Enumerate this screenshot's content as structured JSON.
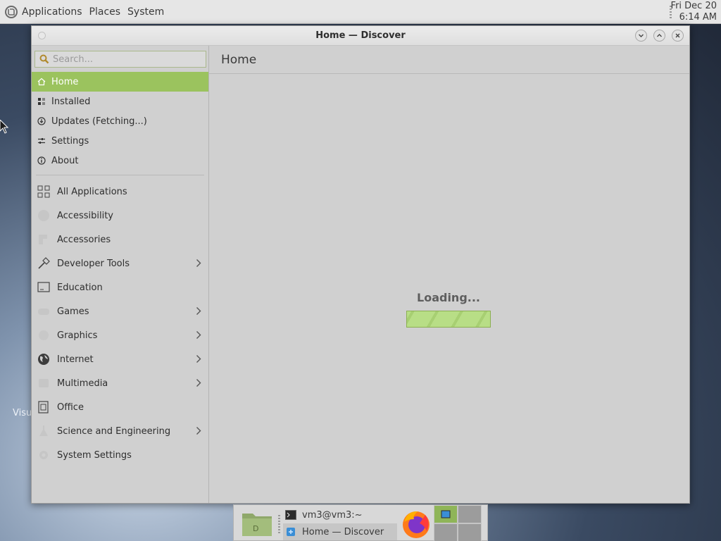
{
  "top_panel": {
    "menus": [
      "Applications",
      "Places",
      "System"
    ],
    "clock_date": "Fri Dec 20",
    "clock_time": "6:14 AM"
  },
  "desktop": {
    "label": "Visu"
  },
  "window": {
    "title": "Home — Discover",
    "search_placeholder": "Search...",
    "nav_items": [
      {
        "label": "Home",
        "icon": "home-icon",
        "active": true
      },
      {
        "label": "Installed",
        "icon": "installed-icon"
      },
      {
        "label": "Updates (Fetching...)",
        "icon": "updates-icon"
      },
      {
        "label": "Settings",
        "icon": "settings-icon"
      },
      {
        "label": "About",
        "icon": "info-icon"
      }
    ],
    "categories": [
      {
        "label": "All Applications",
        "icon": "grid-icon",
        "has_children": false
      },
      {
        "label": "Accessibility",
        "icon": "accessibility-icon",
        "has_children": false
      },
      {
        "label": "Accessories",
        "icon": "accessories-icon",
        "has_children": false
      },
      {
        "label": "Developer Tools",
        "icon": "hammer-icon",
        "has_children": true
      },
      {
        "label": "Education",
        "icon": "education-icon",
        "has_children": false
      },
      {
        "label": "Games",
        "icon": "games-icon",
        "has_children": true
      },
      {
        "label": "Graphics",
        "icon": "graphics-icon",
        "has_children": true
      },
      {
        "label": "Internet",
        "icon": "globe-icon",
        "has_children": true
      },
      {
        "label": "Multimedia",
        "icon": "multimedia-icon",
        "has_children": true
      },
      {
        "label": "Office",
        "icon": "office-icon",
        "has_children": false
      },
      {
        "label": "Science and Engineering",
        "icon": "science-icon",
        "has_children": true
      },
      {
        "label": "System Settings",
        "icon": "system-settings-icon",
        "has_children": false
      }
    ],
    "main_title": "Home",
    "loading_text": "Loading..."
  },
  "taskbar": {
    "tasks": [
      {
        "label": "vm3@vm3:~",
        "icon": "terminal-icon",
        "active": false
      },
      {
        "label": "Home — Discover",
        "icon": "discover-icon",
        "active": true
      }
    ]
  },
  "colors": {
    "accent": "#9bc35e",
    "progress": "#b8de86"
  }
}
